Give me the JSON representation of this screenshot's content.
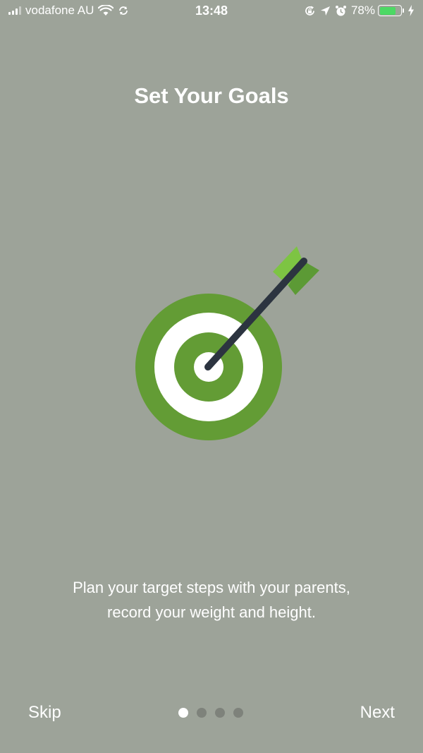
{
  "status_bar": {
    "carrier": "vodafone AU",
    "time": "13:48",
    "battery": "78%",
    "battery_level": 0.78,
    "icons": [
      "signal-icon",
      "wifi-icon",
      "sync-icon",
      "rotation-lock-icon",
      "location-icon",
      "alarm-icon",
      "battery-icon",
      "charging-icon"
    ]
  },
  "onboarding": {
    "title": "Set Your Goals",
    "description_line1": "Plan your target steps with your parents,",
    "description_line2": "record your weight and height.",
    "illustration": "target-arrow-icon",
    "page_index": 1,
    "page_count": 4
  },
  "footer": {
    "skip_label": "Skip",
    "next_label": "Next"
  },
  "colors": {
    "background": "#9da399",
    "target_green": "#639c35",
    "fletching_light": "#7dc443",
    "arrow_shaft": "#2c3440",
    "text": "#ffffff"
  }
}
